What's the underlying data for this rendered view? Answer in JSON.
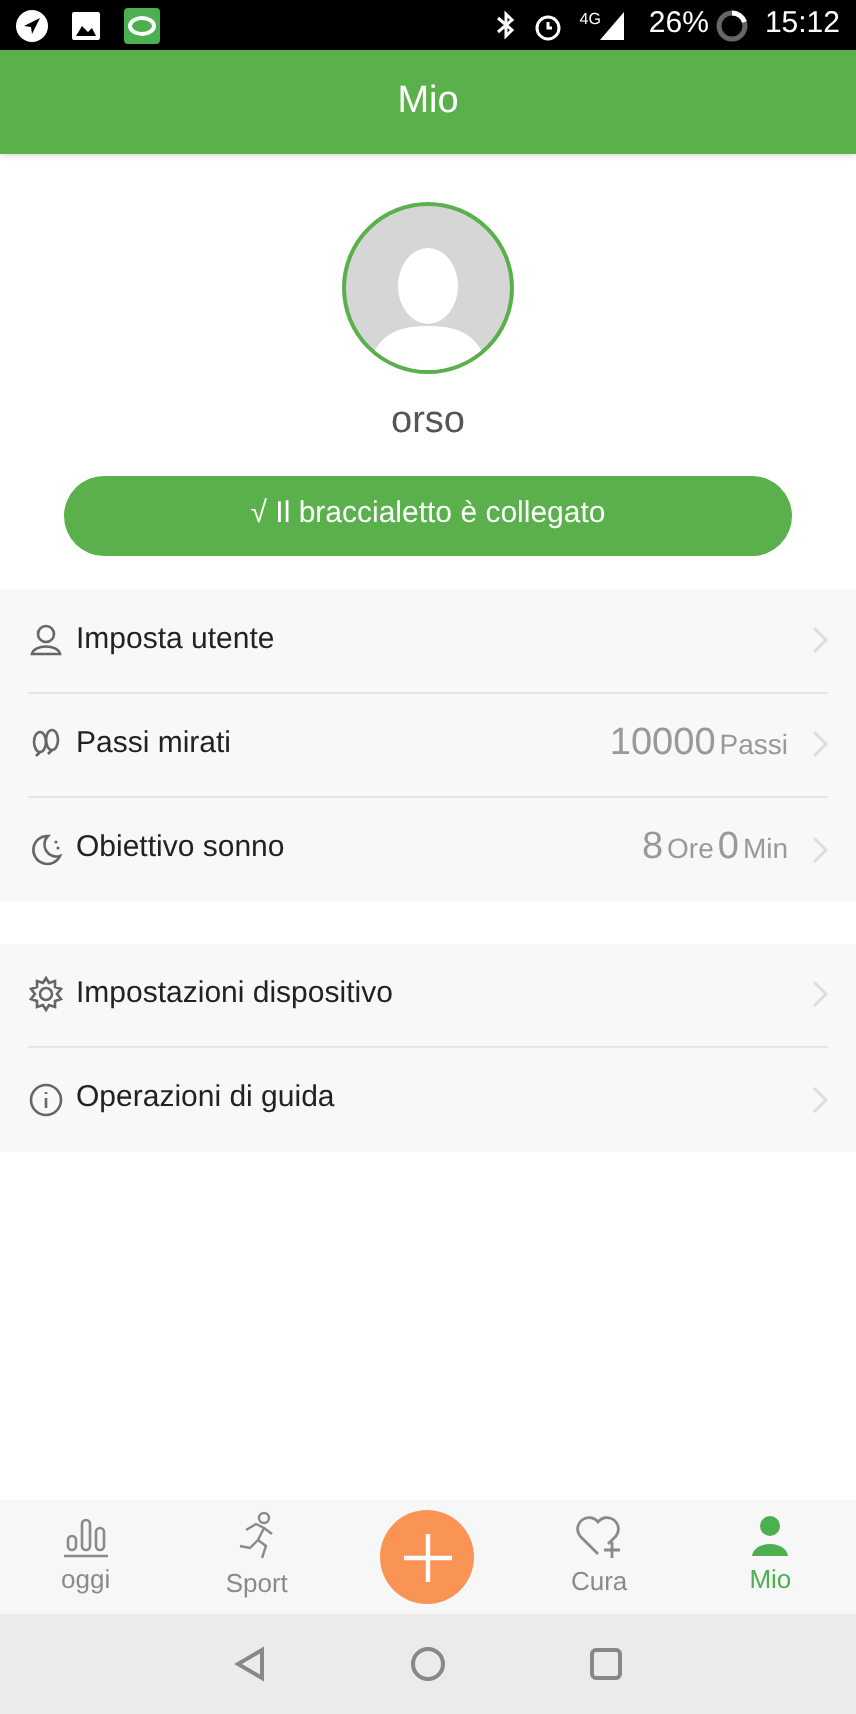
{
  "status_bar": {
    "network": "4G",
    "battery": "26%",
    "time": "15:12"
  },
  "header": {
    "title": "Mio"
  },
  "profile": {
    "name": "orso",
    "connection_button": "√ Il braccialetto è collegato"
  },
  "settings_groups": [
    {
      "items": [
        {
          "kind": "user",
          "label": "Imposta utente",
          "value": []
        },
        {
          "kind": "steps",
          "label": "Passi mirati",
          "value": [
            {
              "kind": "number",
              "text": "10000"
            },
            {
              "kind": "unit",
              "text": "Passi"
            }
          ]
        },
        {
          "kind": "sleep",
          "label": "Obiettivo sonno",
          "value": [
            {
              "kind": "number",
              "text": "8"
            },
            {
              "kind": "unit",
              "text": "Ore"
            },
            {
              "kind": "number",
              "text": "0"
            },
            {
              "kind": "unit",
              "text": "Min"
            }
          ]
        }
      ]
    },
    {
      "items": [
        {
          "kind": "device",
          "label": "Impostazioni dispositivo",
          "value": []
        },
        {
          "kind": "guide",
          "label": "Operazioni di guida",
          "value": []
        }
      ]
    }
  ],
  "tab_bar": [
    {
      "kind": "today",
      "label": "oggi",
      "selected": false
    },
    {
      "kind": "sport",
      "label": "Sport",
      "selected": false
    },
    {
      "kind": "add",
      "selected": false
    },
    {
      "kind": "care",
      "label": "Cura",
      "selected": false
    },
    {
      "kind": "me",
      "label": "Mio",
      "selected": true
    }
  ]
}
